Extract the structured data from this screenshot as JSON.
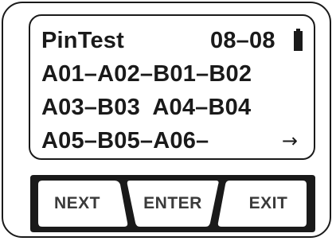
{
  "display": {
    "title": "PinTest",
    "counter": "08–08",
    "battery_icon": "battery-full-icon",
    "rows": [
      "A01–A02–B01–B02",
      "A03–B03  A04–B04",
      "A05–B05–A06–"
    ],
    "more_arrow": "→"
  },
  "keypad": {
    "next_label": "NEXT",
    "enter_label": "ENTER",
    "exit_label": "EXIT"
  },
  "colors": {
    "ink": "#1a1a1a",
    "key_text": "#3a3a3a",
    "background": "#ffffff"
  }
}
